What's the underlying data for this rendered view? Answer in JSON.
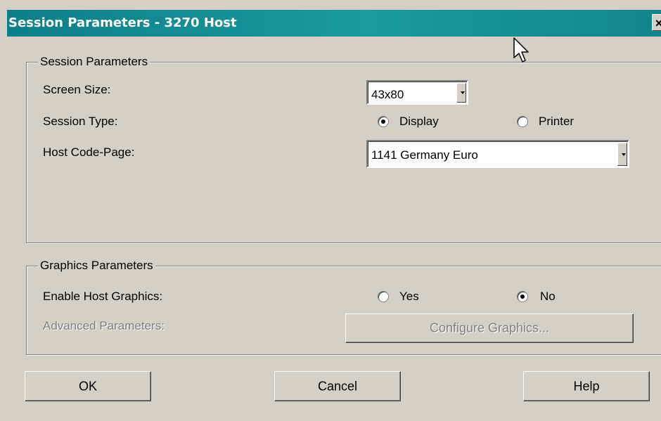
{
  "window": {
    "title": "Session Parameters - 3270 Host",
    "close_label": "×"
  },
  "session_group": {
    "label": "Session Parameters",
    "screen_size_label": "Screen Size:",
    "screen_size_value": "43x80",
    "session_type_label": "Session Type:",
    "session_type_options": [
      {
        "label": "Display",
        "selected": true
      },
      {
        "label": "Printer",
        "selected": false
      }
    ],
    "codepage_label": "Host Code-Page:",
    "codepage_value": "1141 Germany Euro"
  },
  "graphics_group": {
    "label": "Graphics Parameters",
    "enable_label": "Enable Host Graphics:",
    "enable_options": [
      {
        "label": "Yes",
        "selected": false
      },
      {
        "label": "No",
        "selected": true
      }
    ],
    "advanced_label": "Advanced Parameters:",
    "configure_button": "Configure Graphics..."
  },
  "buttons": {
    "ok": "OK",
    "cancel": "Cancel",
    "help": "Help"
  }
}
